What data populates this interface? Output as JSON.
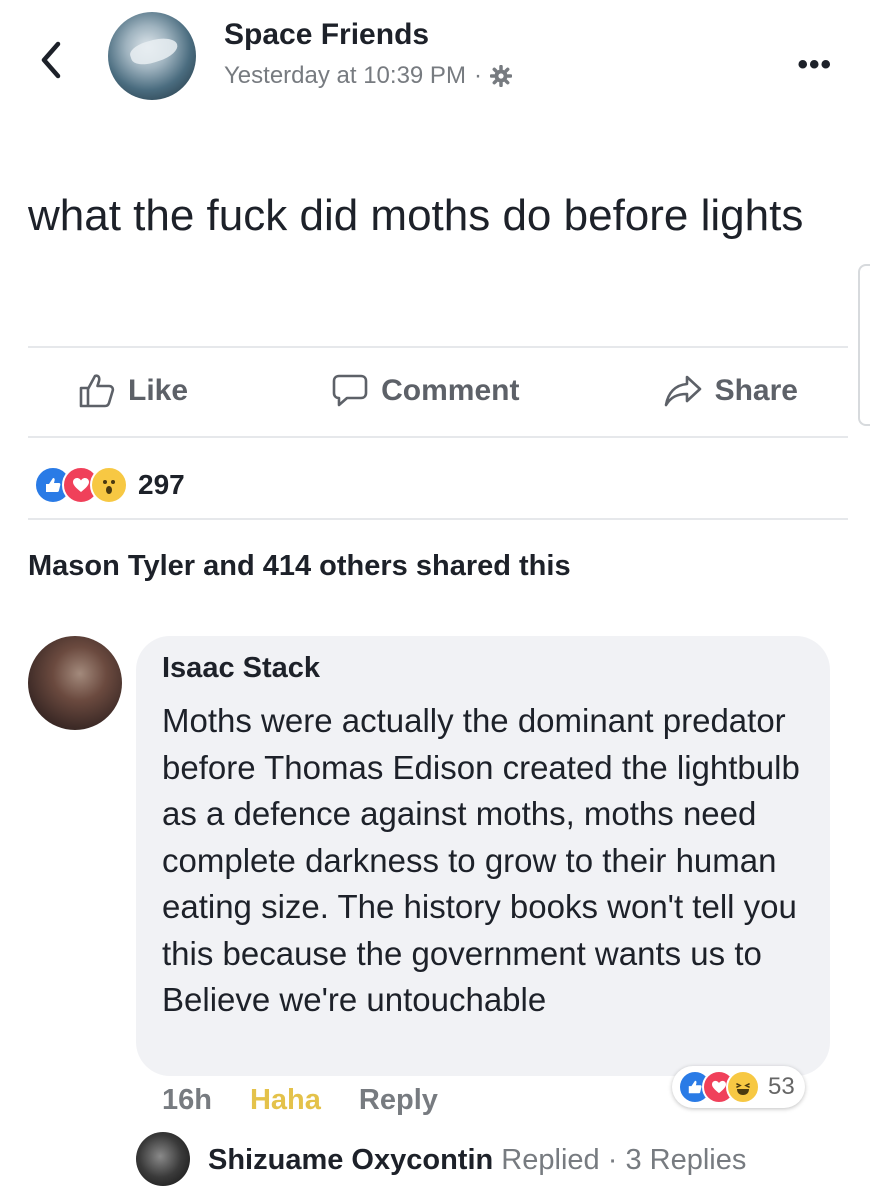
{
  "post": {
    "page_name": "Space Friends",
    "time": "Yesterday at 10:39 PM",
    "separator": "·",
    "text": "what the fuck did moths do before lights",
    "more": "•••"
  },
  "actions": {
    "like": "Like",
    "comment": "Comment",
    "share": "Share"
  },
  "reactions": {
    "count": "297",
    "types": [
      "like",
      "love",
      "wow"
    ]
  },
  "shares": "Mason Tyler and 414 others shared this",
  "comment": {
    "author": "Isaac Stack",
    "text": "Moths were actually the dominant predator before Thomas Edison created the lightbulb as a defence against moths, moths need complete darkness to grow to their human eating size. The history books won't tell you this because the government wants us to Believe we're untouchable",
    "time": "16h",
    "haha": "Haha",
    "reply": "Reply",
    "reactions_count": "53",
    "reaction_types": [
      "like",
      "love",
      "haha"
    ]
  },
  "replies": {
    "name": "Shizuame Oxycontin",
    "replied": "Replied",
    "separator": "·",
    "count_label": "3 Replies"
  },
  "colors": {
    "like_blue": "#2a7be6",
    "love_red": "#f0405a",
    "wow_yellow": "#f7c843",
    "muted_text": "#777b80"
  }
}
